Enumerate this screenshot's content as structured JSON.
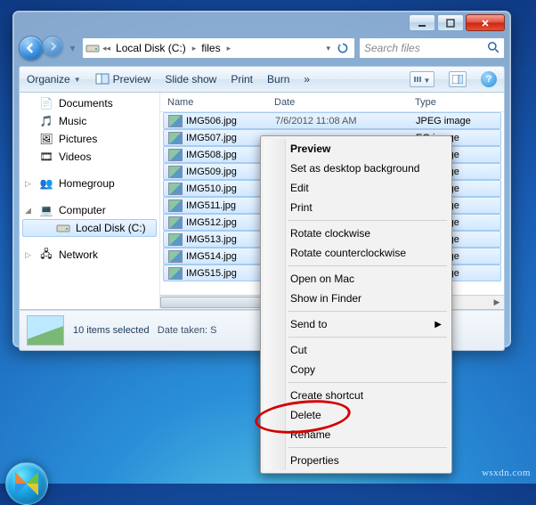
{
  "address": {
    "drive": "Local Disk (C:)",
    "folder": "files"
  },
  "search": {
    "placeholder": "Search files"
  },
  "toolbar": {
    "organize": "Organize",
    "preview": "Preview",
    "slideshow": "Slide show",
    "print": "Print",
    "burn": "Burn",
    "overflow": "»"
  },
  "nav": {
    "items": [
      {
        "label": "Documents",
        "icon": "documents"
      },
      {
        "label": "Music",
        "icon": "music"
      },
      {
        "label": "Pictures",
        "icon": "pictures"
      },
      {
        "label": "Videos",
        "icon": "videos"
      }
    ],
    "homegroup": "Homegroup",
    "computer": "Computer",
    "localdisk": "Local Disk (C:)",
    "network": "Network"
  },
  "columns": {
    "name": "Name",
    "date": "Date",
    "type": "Type"
  },
  "files": [
    {
      "name": "IMG506.jpg",
      "date": "7/6/2012 11:08 AM",
      "type": "JPEG image"
    },
    {
      "name": "IMG507.jpg",
      "date": "",
      "type": "EG image"
    },
    {
      "name": "IMG508.jpg",
      "date": "",
      "type": "EG image"
    },
    {
      "name": "IMG509.jpg",
      "date": "",
      "type": "EG image"
    },
    {
      "name": "IMG510.jpg",
      "date": "",
      "type": "EG image"
    },
    {
      "name": "IMG511.jpg",
      "date": "",
      "type": "EG image"
    },
    {
      "name": "IMG512.jpg",
      "date": "",
      "type": "EG image"
    },
    {
      "name": "IMG513.jpg",
      "date": "",
      "type": "EG image"
    },
    {
      "name": "IMG514.jpg",
      "date": "",
      "type": "EG image"
    },
    {
      "name": "IMG515.jpg",
      "date": "",
      "type": "EG image"
    }
  ],
  "details": {
    "count": "10 items selected",
    "taken_label": "Date taken:",
    "taken_value": "S"
  },
  "context": {
    "preview": "Preview",
    "setbg": "Set as desktop background",
    "edit": "Edit",
    "print": "Print",
    "rotcw": "Rotate clockwise",
    "rotccw": "Rotate counterclockwise",
    "openmac": "Open on Mac",
    "showfinder": "Show in Finder",
    "sendto": "Send to",
    "cut": "Cut",
    "copy": "Copy",
    "shortcut": "Create shortcut",
    "delete": "Delete",
    "rename": "Rename",
    "properties": "Properties"
  },
  "watermark": "wsxdn.com"
}
